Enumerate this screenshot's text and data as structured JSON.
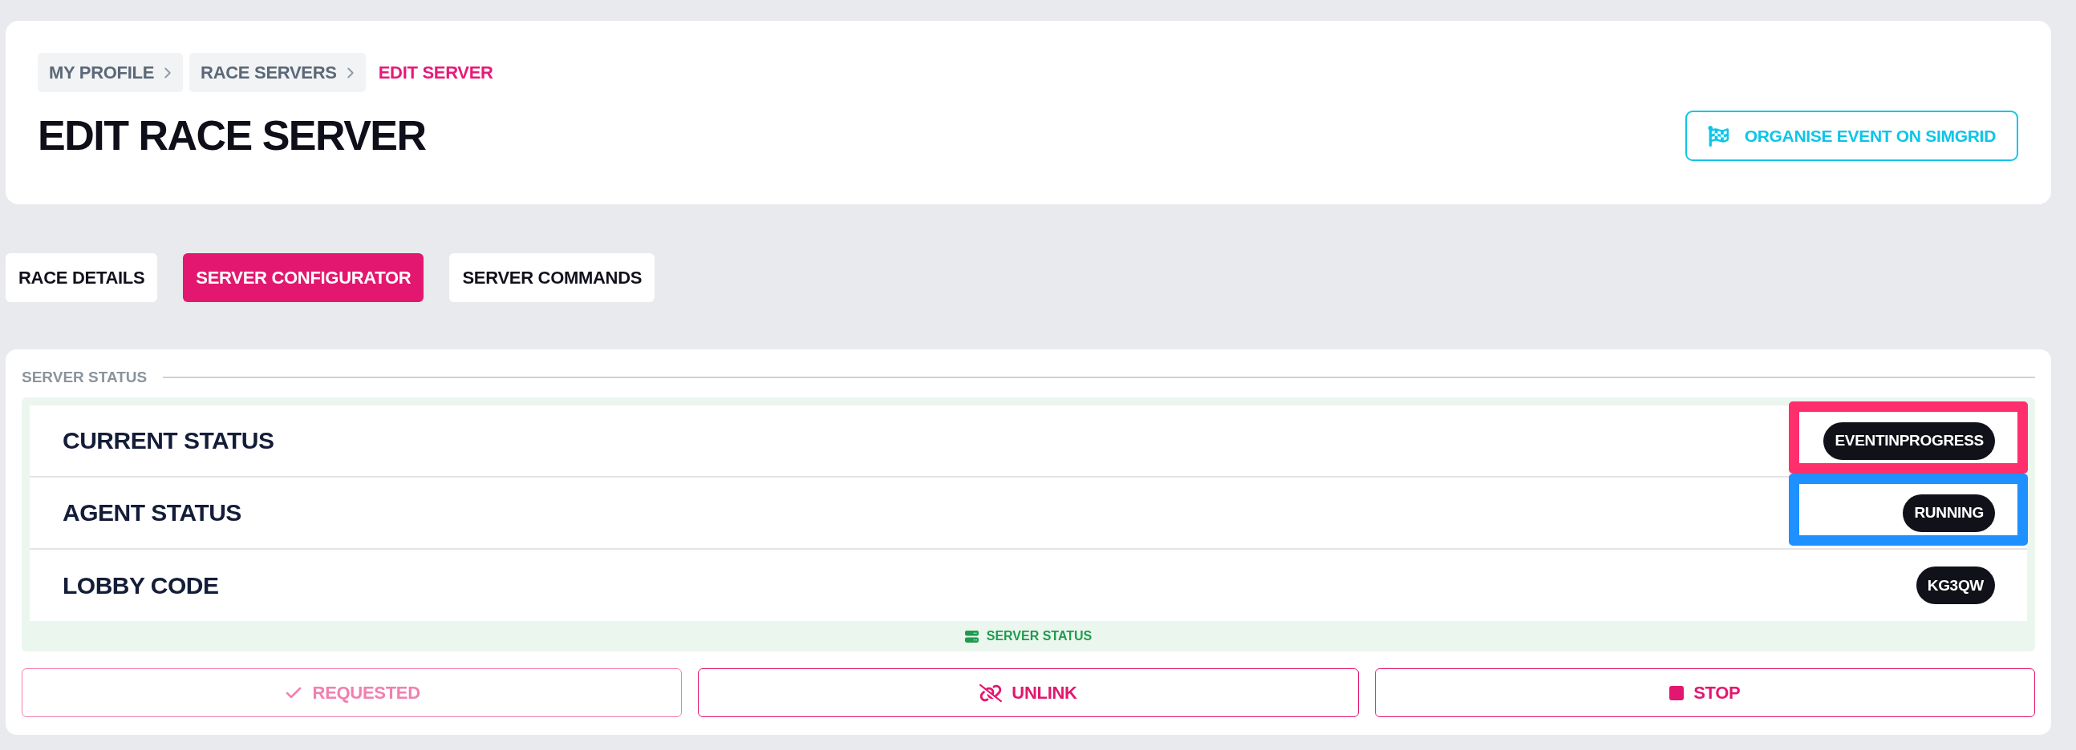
{
  "breadcrumb": [
    {
      "label": "MY PROFILE",
      "current": false
    },
    {
      "label": "RACE SERVERS",
      "current": false
    },
    {
      "label": "EDIT SERVER",
      "current": true
    }
  ],
  "page_title": "EDIT RACE SERVER",
  "organise_button": {
    "label": "ORGANISE EVENT ON SIMGRID"
  },
  "tabs": [
    {
      "label": "RACE DETAILS",
      "selected": false
    },
    {
      "label": "SERVER CONFIGURATOR",
      "selected": true
    },
    {
      "label": "SERVER COMMANDS",
      "selected": false
    }
  ],
  "server_status": {
    "title": "SERVER STATUS",
    "rows": [
      {
        "label": "CURRENT STATUS",
        "value": "EVENTINPROGRESS",
        "highlight": {
          "color": "#ff2e6c"
        }
      },
      {
        "label": "AGENT STATUS",
        "value": "RUNNING",
        "highlight": {
          "color": "#1e90ff"
        }
      },
      {
        "label": "LOBBY CODE",
        "value": "KG3QW"
      }
    ],
    "footer": "SERVER STATUS"
  },
  "actions": [
    {
      "kind": "check",
      "label": "REQUESTED",
      "disabled": true
    },
    {
      "kind": "unlink",
      "label": "UNLINK",
      "disabled": false
    },
    {
      "kind": "stop",
      "label": "STOP",
      "disabled": false
    }
  ]
}
